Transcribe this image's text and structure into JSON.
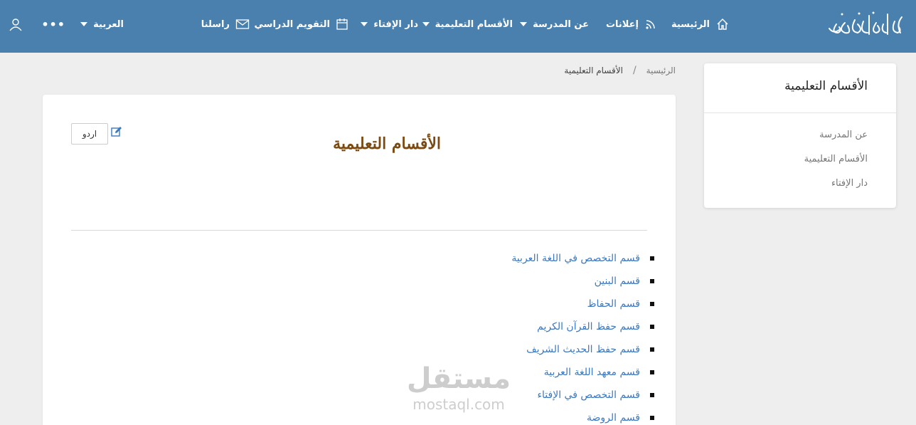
{
  "header": {
    "logo_text": "مدرسة ابن عباس",
    "nav": [
      {
        "label": "الرئيسية",
        "icon": "home-icon"
      },
      {
        "label": "إعلانات",
        "icon": "rss-icon"
      },
      {
        "label": "عن المدرسة",
        "dropdown": true
      },
      {
        "label": "الأقسام التعليمية",
        "dropdown": true
      },
      {
        "label": "دار الإفتاء",
        "dropdown": true
      },
      {
        "label": "التقويم الدراسي",
        "icon": "calendar-icon"
      },
      {
        "label": "راسلنا",
        "icon": "envelope-icon"
      }
    ],
    "language": "العربية",
    "more": "•••"
  },
  "breadcrumb": {
    "home": "الرئيسية",
    "separator": "/",
    "current": "الأقسام التعليمية"
  },
  "sidebar": {
    "title": "الأقسام التعليمية",
    "links": [
      "عن المدرسة",
      "الأقسام التعليمية",
      "دار الإفتاء"
    ]
  },
  "main": {
    "title": "الأقسام التعليمية",
    "lang_button": "اردو",
    "departments": [
      "قسم التخصص في اللغة العربية",
      "قسم البنين",
      "قسم الحفاظ",
      "قسم حفظ القرآن الكريم",
      "قسم حفظ الحديث الشريف",
      "قسم معهد اللغة العربية",
      "قسم التخصص في الإفتاء",
      "قسم الروضة"
    ]
  },
  "watermark": {
    "arabic": "مستقل",
    "latin": "mostaql.com"
  },
  "colors": {
    "header_bg": "#4a80ad",
    "title": "#7a4a12",
    "link": "#3a78c2"
  }
}
